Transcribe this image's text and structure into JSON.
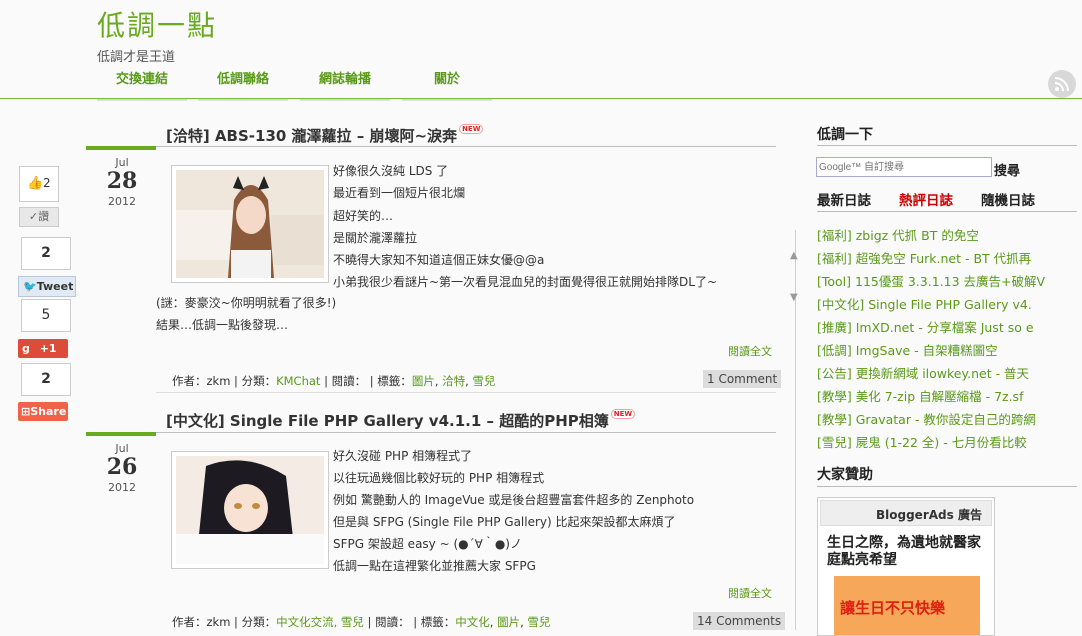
{
  "header": {
    "title": "低調一點",
    "description": "低調才是王道",
    "nav": [
      "交換連結",
      "低調聯絡",
      "網誌輪播",
      "關於"
    ]
  },
  "share": {
    "like_count": "2",
    "like_btn": "讚",
    "tweet_count": "2",
    "tweet_btn": "Tweet",
    "gplus_count": "5",
    "gplus_btn": "+1",
    "share_count": "2",
    "share_btn": "Share"
  },
  "posts": [
    {
      "title": "[洽特] ABS-130 瀧澤蘿拉 – 崩壞阿~淚奔",
      "new_badge": "NEW",
      "month": "Jul",
      "day": "28",
      "year": "2012",
      "lines": [
        "好像很久沒純 LDS 了",
        "最近看到一個短片很北爛",
        "超好笑的…",
        "是關於瀧澤蘿拉",
        "不曉得大家知不知道這個正妹女優@@a",
        "小弟我很少看謎片~第一次看見混血兒的封面覺得很正就開始排隊DL了~",
        "(謎：麥豪洨~你明明就看了很多!)",
        "結果…低調一點後發現…"
      ],
      "read_more": "閱讀全文",
      "meta_author": "作者：zkm | 分類：",
      "meta_category": "KMChat",
      "meta_mid": " | 閱讀： | 標籤：",
      "tags": [
        "圖片",
        "洽特",
        "雪兒"
      ],
      "comments": "1 Comment"
    },
    {
      "title": "[中文化] Single File PHP Gallery v4.1.1 – 超酷的PHP相簿",
      "new_badge": "NEW",
      "month": "Jul",
      "day": "26",
      "year": "2012",
      "lines": [
        "好久沒碰 PHP 相簿程式了",
        "以往玩過幾個比較好玩的 PHP 相簿程式",
        "例如 驚艷動人的 ImageVue 或是後台超豐富套件超多的 Zenphoto",
        "但是與 SFPG (Single File PHP Gallery) 比起來架設都太麻煩了",
        "SFPG 架設超 easy ~ (●´∀｀●)ノ",
        "低調一點在這裡繁化並推薦大家 SFPG"
      ],
      "read_more": "閱讀全文",
      "meta_author": "作者：zkm | 分類：",
      "meta_category": "中文化交流, 雪兒",
      "meta_mid": " | 閱讀： | 標籤：",
      "tags": [
        "中文化",
        "圖片",
        "雪兒"
      ],
      "comments": "14 Comments"
    }
  ],
  "sidebar": {
    "search_heading": "低調一下",
    "search_placeholder": "Google™ 自訂搜尋",
    "search_btn": "搜尋",
    "tabs": [
      "最新日誌",
      "熱評日誌",
      "隨機日誌"
    ],
    "items": [
      "[福利] zbigz 代抓 BT 的免空",
      "[福利] 超強免空 Furk.net - BT 代抓再",
      "[Tool] 115優蛋 3.3.1.13 去廣告+破解V",
      "[中文化] Single File PHP Gallery v4.",
      "[推廣] ImXD.net - 分享檔案 Just so e",
      "[低調] ImgSave - 自架糟糕圖空",
      "[公告] 更換新網域 ilowkey.net - 普天",
      "[教學] 美化 7-zip 自解壓縮檔 - 7z.sf",
      "[教學] Gravatar - 教你設定自己的跨網",
      "[雪兒] 屍鬼 (1-22 全) - 七月份看比較"
    ],
    "sponsor_heading": "大家贊助",
    "ads_label": "BloggerAds 廣告",
    "ad_text": "生日之際，為遺地就醫家庭點亮希望",
    "ad_banner": "讓生日不只快樂"
  },
  "colors": {
    "accent": "#6aaa1e",
    "link": "#5a9a1a",
    "hot_tab": "#cc0000"
  }
}
